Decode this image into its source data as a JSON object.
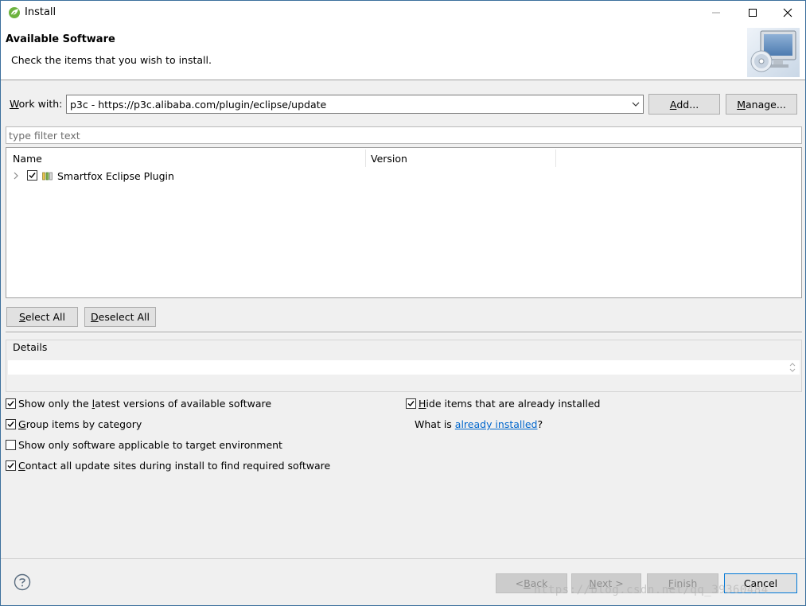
{
  "window": {
    "title": "Install",
    "banner_title": "Available Software",
    "banner_description": "Check the items that you wish to install."
  },
  "work_with": {
    "label_prefix": "W",
    "label_rest": "ork with:",
    "value": "p3c - https://p3c.alibaba.com/plugin/eclipse/update",
    "add_label_u": "A",
    "add_label_rest": "dd...",
    "manage_label_u": "M",
    "manage_label_rest": "anage..."
  },
  "filter": {
    "placeholder": "type filter text"
  },
  "tree": {
    "columns": [
      "Name",
      "Version"
    ],
    "items": [
      {
        "label": "Smartfox Eclipse Plugin",
        "version": "",
        "checked": true
      }
    ]
  },
  "selection_buttons": {
    "select_all_u": "S",
    "select_all_rest": "elect All",
    "deselect_all_u": "D",
    "deselect_all_rest": "eselect All"
  },
  "details": {
    "label": "Details",
    "text": ""
  },
  "options": {
    "latest_pre": "Show only the ",
    "latest_u": "l",
    "latest_post": "atest versions of available software",
    "latest_checked": true,
    "group_u": "G",
    "group_post": "roup items by category",
    "group_checked": true,
    "applicable": "Show only software applicable to target environment",
    "applicable_checked": false,
    "contact_u": "C",
    "contact_post": "ontact all update sites during install to find required software",
    "contact_checked": true,
    "hide_u": "H",
    "hide_post": "ide items that are already installed",
    "hide_checked": true,
    "what_is": "What is ",
    "already_installed_link": "already installed",
    "question_mark": "?"
  },
  "footer": {
    "back_pre": "< ",
    "back_u": "B",
    "back_post": "ack",
    "next_u": "N",
    "next_post": "ext >",
    "finish_u": "F",
    "finish_post": "inish",
    "cancel": "Cancel",
    "watermark": "https://blog.csdn.net/qq_39360484"
  },
  "colors": {
    "link": "#0066cc",
    "window_border": "#3c6f9c",
    "spring_green": "#6db33f"
  },
  "icons": [
    "spring-app-icon",
    "minimize-icon",
    "maximize-icon",
    "close-icon",
    "install-banner-icon",
    "dropdown-chevron-icon",
    "tree-expand-icon",
    "feature-icon",
    "help-icon"
  ]
}
